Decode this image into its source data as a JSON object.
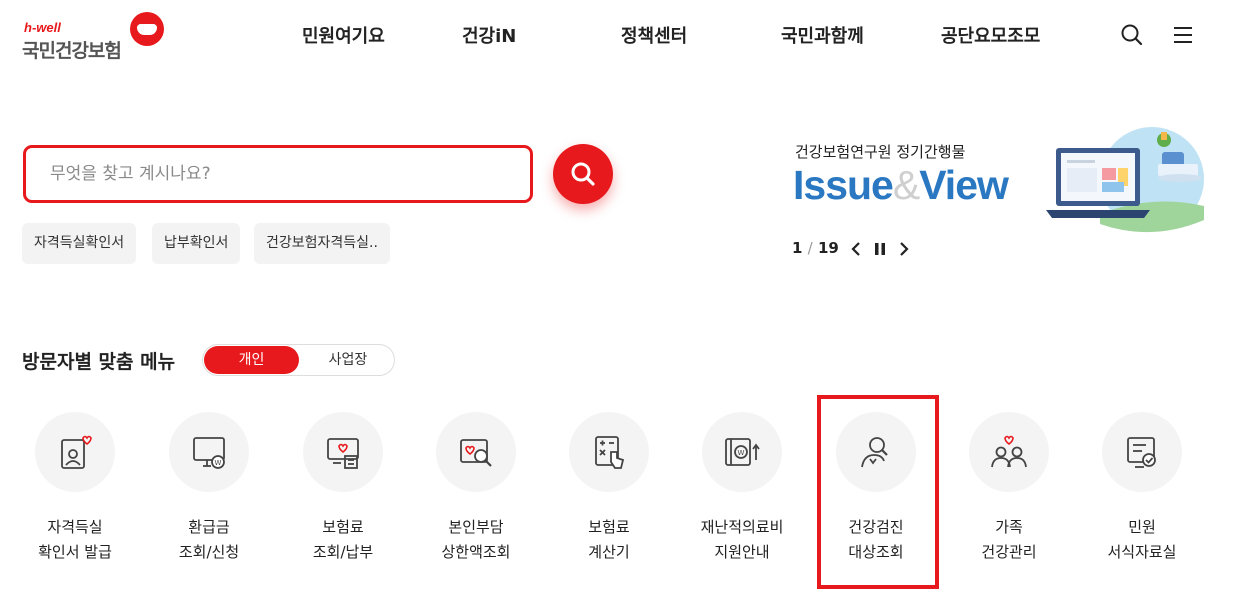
{
  "header": {
    "logo_sub": "h-well",
    "logo_main": "국민건강보험",
    "nav": [
      "민원여기요",
      "건강iN",
      "정책센터",
      "국민과함께",
      "공단요모조모"
    ],
    "icons": [
      "search-icon",
      "hamburger-menu-icon"
    ]
  },
  "search": {
    "placeholder": "무엇을 찾고 계시나요?",
    "keywords": [
      "자격득실확인서",
      "납부확인서",
      "건강보험자격득실.."
    ]
  },
  "banner": {
    "subtitle": "건강보험연구원 정기간행물",
    "title_a": "Issue",
    "title_amp": "&",
    "title_b": "View",
    "page_current": "1",
    "page_sep": "/",
    "page_total": "19",
    "controls": [
      "chevron-left-icon",
      "pause-icon",
      "chevron-right-icon"
    ]
  },
  "visitor_menu": {
    "title": "방문자별 맞춤 메뉴",
    "tab_personal": "개인",
    "tab_business": "사업장",
    "items": [
      {
        "line1": "자격득실",
        "line2": "확인서 발급",
        "icon": "id-card-heart-icon"
      },
      {
        "line1": "환급금",
        "line2": "조회/신청",
        "icon": "monitor-won-icon"
      },
      {
        "line1": "보험료",
        "line2": "조회/납부",
        "icon": "receipt-heart-icon"
      },
      {
        "line1": "본인부담",
        "line2": "상한액조회",
        "icon": "heart-search-icon"
      },
      {
        "line1": "보험료",
        "line2": "계산기",
        "icon": "calculator-hand-icon"
      },
      {
        "line1": "재난적의료비",
        "line2": "지원안내",
        "icon": "won-wallet-arrow-icon"
      },
      {
        "line1": "건강검진",
        "line2": "대상조회",
        "icon": "person-search-icon"
      },
      {
        "line1": "가족",
        "line2": "건강관리",
        "icon": "family-heart-icon"
      },
      {
        "line1": "민원",
        "line2": "서식자료실",
        "icon": "document-check-icon"
      }
    ]
  },
  "colors": {
    "brand_red": "#e8191c",
    "banner_blue": "#2a78c2"
  }
}
